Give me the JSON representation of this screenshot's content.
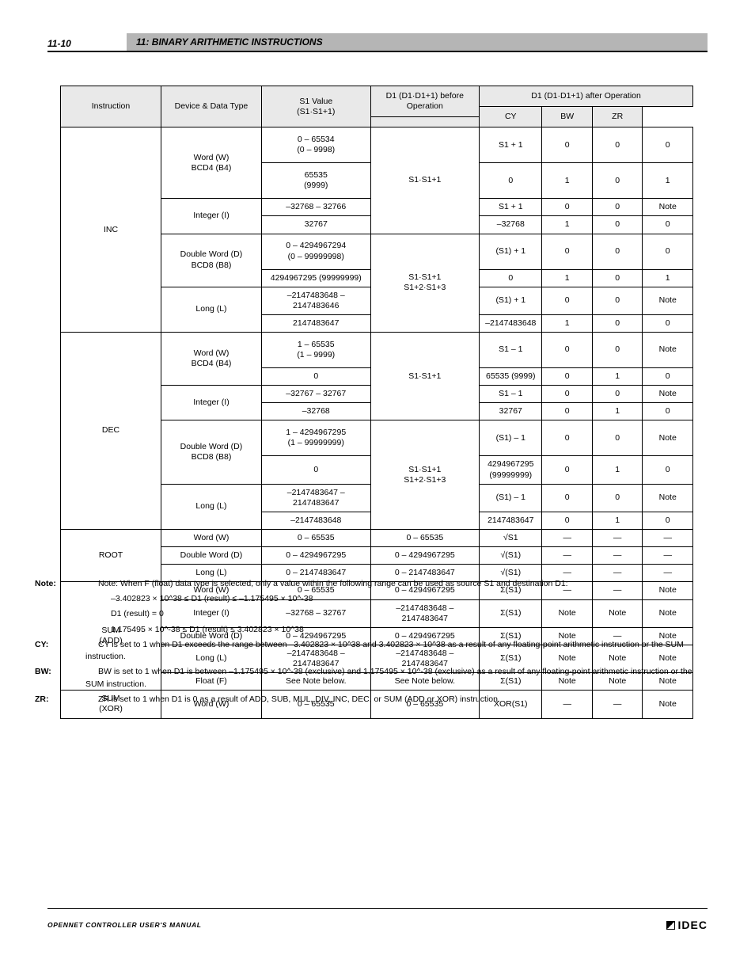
{
  "header": {
    "page_number": "11-10",
    "title": "11: BINARY ARITHMETIC INSTRUCTIONS"
  },
  "table": {
    "headers": {
      "instruction": "Instruction",
      "device_type": "Device & Data Type",
      "s1_value": "S1 Value\n(S1·S1+1)",
      "d1_pre": "D1 (D1·D1+1) before Operation",
      "d1_out": "D1 (D1·D1+1) after Operation",
      "cy": "CY",
      "bw": "BW",
      "zr": "ZR"
    },
    "groups": [
      {
        "instr": "INC",
        "rows": [
          {
            "devtype": "Word (W)\nBCD4 (B4)",
            "s1": "0 – 65534\n(0 – 9998)",
            "d1pre": "S1·S1+1",
            "d1out": "S1 + 1",
            "cy": "0",
            "bw": "0",
            "zr": "0"
          },
          {
            "devtype": "",
            "s1": "65535\n(9999)",
            "d1pre": "",
            "d1out": "0",
            "cy": "1",
            "bw": "0",
            "zr": "1"
          },
          {
            "devtype": "Integer (I)",
            "s1": "–32768 – 32766",
            "d1pre": "",
            "d1out": "S1 + 1",
            "cy": "0",
            "bw": "0",
            "zr": "Note"
          },
          {
            "devtype": "",
            "s1": "32767",
            "d1pre": "",
            "d1out": "–32768",
            "cy": "1",
            "bw": "0",
            "zr": "0"
          },
          {
            "devtype": "Double Word (D)\nBCD8 (B8)",
            "s1": "0 – 4294967294\n(0 – 99999998)",
            "d1pre": "S1·S1+1\nS1+2·S1+3",
            "d1out": "(S1) + 1",
            "cy": "0",
            "bw": "0",
            "zr": "0"
          },
          {
            "devtype": "",
            "s1": "4294967295 (99999999)",
            "d1pre": "",
            "d1out": "0",
            "cy": "1",
            "bw": "0",
            "zr": "1"
          },
          {
            "devtype": "Long (L)",
            "s1": "–2147483648 – 2147483646",
            "d1pre": "",
            "d1out": "(S1) + 1",
            "cy": "0",
            "bw": "0",
            "zr": "Note"
          },
          {
            "devtype": "",
            "s1": "2147483647",
            "d1pre": "",
            "d1out": "–2147483648",
            "cy": "1",
            "bw": "0",
            "zr": "0"
          }
        ]
      },
      {
        "instr": "DEC",
        "rows": [
          {
            "devtype": "Word (W)\nBCD4 (B4)",
            "s1": "1 – 65535\n(1 – 9999)",
            "d1pre": "S1·S1+1",
            "d1out": "S1 – 1",
            "cy": "0",
            "bw": "0",
            "zr": "Note"
          },
          {
            "devtype": "",
            "s1": "0",
            "d1pre": "",
            "d1out": "65535 (9999)",
            "cy": "0",
            "bw": "1",
            "zr": "0"
          },
          {
            "devtype": "Integer (I)",
            "s1": "–32767 – 32767",
            "d1pre": "",
            "d1out": "S1 – 1",
            "cy": "0",
            "bw": "0",
            "zr": "Note"
          },
          {
            "devtype": "",
            "s1": "–32768",
            "d1pre": "",
            "d1out": "32767",
            "cy": "0",
            "bw": "1",
            "zr": "0"
          },
          {
            "devtype": "Double Word (D)\nBCD8 (B8)",
            "s1": "1 – 4294967295\n(1 – 99999999)",
            "d1pre": "S1·S1+1\nS1+2·S1+3",
            "d1out": "(S1) – 1",
            "cy": "0",
            "bw": "0",
            "zr": "Note"
          },
          {
            "devtype": "",
            "s1": "0",
            "d1pre": "",
            "d1out": "4294967295\n(99999999)",
            "cy": "0",
            "bw": "1",
            "zr": "0"
          },
          {
            "devtype": "Long (L)",
            "s1": "–2147483647 – 2147483647",
            "d1pre": "",
            "d1out": "(S1) – 1",
            "cy": "0",
            "bw": "0",
            "zr": "Note"
          },
          {
            "devtype": "",
            "s1": "–2147483648",
            "d1pre": "",
            "d1out": "2147483647",
            "cy": "0",
            "bw": "1",
            "zr": "0"
          }
        ]
      },
      {
        "instr": "ROOT",
        "rows": [
          {
            "devtype": "Word (W)",
            "s1": "0 – 65535",
            "d1pre": "0 – 65535",
            "d1out": "√S1",
            "cy": "—",
            "bw": "—",
            "zr": "—"
          },
          {
            "devtype": "Double Word (D)",
            "s1": "0 – 4294967295",
            "d1pre": "0 – 4294967295",
            "d1out": "√(S1)",
            "cy": "—",
            "bw": "—",
            "zr": "—"
          },
          {
            "devtype": "Long (L)",
            "s1": "0 – 2147483647",
            "d1pre": "0 – 2147483647",
            "d1out": "√(S1)",
            "cy": "—",
            "bw": "—",
            "zr": "—"
          }
        ]
      },
      {
        "instr": "SUM\n(ADD)",
        "rows": [
          {
            "devtype": "Word (W)",
            "s1": "0 – 65535",
            "d1pre": "0 – 4294967295",
            "d1out": "Σ(S1)",
            "cy": "—",
            "bw": "—",
            "zr": "Note"
          },
          {
            "devtype": "Integer (I)",
            "s1": "–32768 – 32767",
            "d1pre": "–2147483648 – 2147483647",
            "d1out": "Σ(S1)",
            "cy": "Note",
            "bw": "Note",
            "zr": "Note"
          },
          {
            "devtype": "Double Word (D)",
            "s1": "0 – 4294967295",
            "d1pre": "0 – 4294967295",
            "d1out": "Σ(S1)",
            "cy": "Note",
            "bw": "—",
            "zr": "Note"
          },
          {
            "devtype": "Long (L)",
            "s1": "–2147483648 – 2147483647",
            "d1pre": "–2147483648 – 2147483647",
            "d1out": "Σ(S1)",
            "cy": "Note",
            "bw": "Note",
            "zr": "Note"
          },
          {
            "devtype": "Float (F)",
            "s1": "See Note below.",
            "d1pre": "See Note below.",
            "d1out": "Σ(S1)",
            "cy": "Note",
            "bw": "Note",
            "zr": "Note"
          }
        ]
      },
      {
        "instr": "SUM\n(XOR)",
        "rows": [
          {
            "devtype": "Word (W)",
            "s1": "0 – 65535",
            "d1pre": "0 – 65535",
            "d1out": "XOR(S1)",
            "cy": "—",
            "bw": "—",
            "zr": "Note"
          }
        ]
      }
    ]
  },
  "notes": {
    "intro": "Note: When F (float) data type is selected, only a value within the following range can be used as source S1 and destination D1:",
    "float_ranges": [
      "–3.402823 × 10^38 ≤ D1 (result) ≤ –1.175495 × 10^-38",
      "D1 (result) = 0",
      "1.175495 × 10^-38 ≤ D1 (result) ≤ 3.402823 × 10^38"
    ],
    "cy": "CY is set to 1 when D1 exceeds the range between –3.402823 × 10^38 and 3.402823 × 10^38 as a result of any floating-point arithmetic instruction or the SUM instruction.",
    "bw": "BW is set to 1 when D1 is between –1.175495 × 10^-38 (exclusive) and 1.175495 × 10^-38 (exclusive) as a result of any floating-point arithmetic instruction or the SUM instruction.",
    "zr": "ZR is set to 1 when D1 is 0 as a result of ADD, SUB, MUL, DIV, INC, DEC, or SUM (ADD or XOR) instruction."
  },
  "footer": {
    "manual": "OPENNET CONTROLLER USER'S MANUAL",
    "logo_text": "IDEC"
  }
}
